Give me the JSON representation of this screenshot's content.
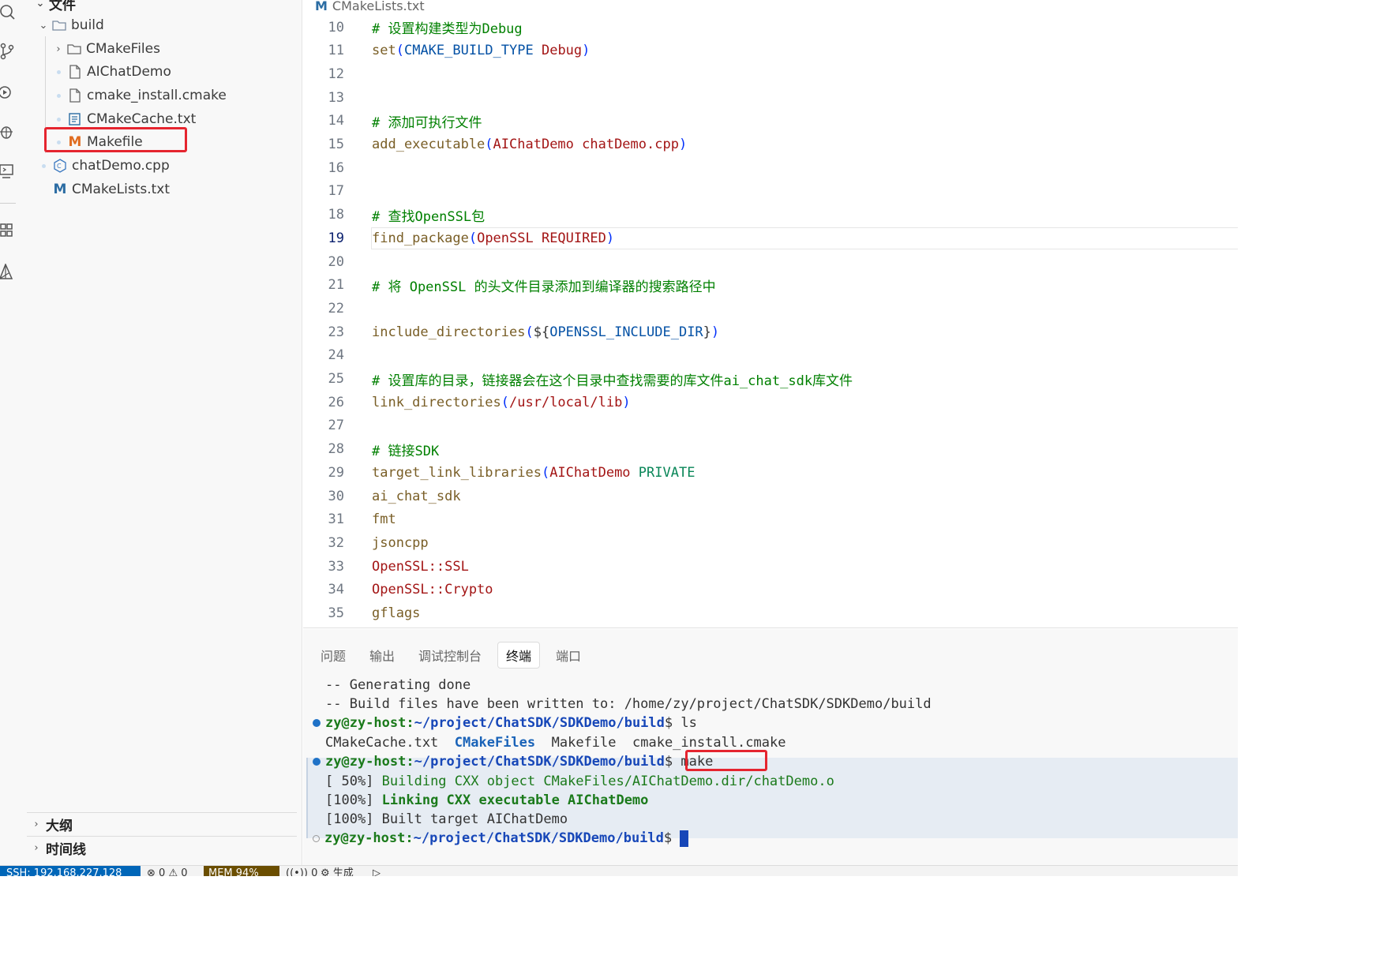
{
  "sidebar": {
    "section_title": "文件",
    "tree": [
      {
        "label": "build"
      },
      {
        "label": "CMakeFiles"
      },
      {
        "label": "AIChatDemo"
      },
      {
        "label": "cmake_install.cmake"
      },
      {
        "label": "CMakeCache.txt"
      },
      {
        "label": "Makefile",
        "icon_letter": "M"
      },
      {
        "label": "chatDemo.cpp"
      },
      {
        "label": "CMakeLists.txt",
        "icon_letter": "M"
      }
    ],
    "outline_label": "大纲",
    "timeline_label": "时间线"
  },
  "editor": {
    "tab_label": "CMakeLists.txt",
    "tab_icon_letter": "M",
    "active_line": 19,
    "lines": [
      {
        "n": "10",
        "tokens": [
          {
            "t": "# 设置构建类型为Debug",
            "c": "cmt"
          }
        ]
      },
      {
        "n": "11",
        "tokens": [
          {
            "t": "set",
            "c": "fn"
          },
          {
            "t": "(",
            "c": "brk"
          },
          {
            "t": "CMAKE_BUILD_TYPE",
            "c": "var"
          },
          {
            "t": " Debug",
            "c": "str"
          },
          {
            "t": ")",
            "c": "brk"
          }
        ]
      },
      {
        "n": "12",
        "tokens": []
      },
      {
        "n": "13",
        "tokens": []
      },
      {
        "n": "14",
        "tokens": [
          {
            "t": "# 添加可执行文件",
            "c": "cmt"
          }
        ]
      },
      {
        "n": "15",
        "tokens": [
          {
            "t": "add_executable",
            "c": "fn"
          },
          {
            "t": "(",
            "c": "brk"
          },
          {
            "t": "AIChatDemo chatDemo.cpp",
            "c": "str"
          },
          {
            "t": ")",
            "c": "brk"
          }
        ]
      },
      {
        "n": "16",
        "tokens": []
      },
      {
        "n": "17",
        "tokens": []
      },
      {
        "n": "18",
        "tokens": [
          {
            "t": "# 查找OpenSSL包",
            "c": "cmt"
          }
        ]
      },
      {
        "n": "19",
        "tokens": [
          {
            "t": "find_package",
            "c": "fn"
          },
          {
            "t": "(",
            "c": "brk"
          },
          {
            "t": "OpenSSL REQUIRED",
            "c": "str"
          },
          {
            "t": ")",
            "c": "brk"
          }
        ]
      },
      {
        "n": "20",
        "tokens": []
      },
      {
        "n": "21",
        "tokens": [
          {
            "t": "# 将 OpenSSL 的头文件目录添加到编译器的搜索路径中",
            "c": "cmt"
          }
        ]
      },
      {
        "n": "22",
        "tokens": []
      },
      {
        "n": "23",
        "tokens": [
          {
            "t": "include_directories",
            "c": "fn"
          },
          {
            "t": "(",
            "c": "brk"
          },
          {
            "t": "${",
            "c": "pl"
          },
          {
            "t": "OPENSSL_INCLUDE_DIR",
            "c": "var"
          },
          {
            "t": "}",
            "c": "pl"
          },
          {
            "t": ")",
            "c": "brk"
          }
        ]
      },
      {
        "n": "24",
        "tokens": []
      },
      {
        "n": "25",
        "tokens": [
          {
            "t": "# 设置库的目录，链接器会在这个目录中查找需要的库文件ai_chat_sdk库文件",
            "c": "cmt"
          }
        ]
      },
      {
        "n": "26",
        "tokens": [
          {
            "t": "link_directories",
            "c": "fn"
          },
          {
            "t": "(",
            "c": "brk"
          },
          {
            "t": "/usr/local/lib",
            "c": "str"
          },
          {
            "t": ")",
            "c": "brk"
          }
        ]
      },
      {
        "n": "27",
        "tokens": []
      },
      {
        "n": "28",
        "tokens": [
          {
            "t": "# 链接SDK",
            "c": "cmt"
          }
        ]
      },
      {
        "n": "29",
        "tokens": [
          {
            "t": "target_link_libraries",
            "c": "fn"
          },
          {
            "t": "(",
            "c": "brk"
          },
          {
            "t": "AIChatDemo",
            "c": "str"
          },
          {
            "t": " PRIVATE",
            "c": "kw"
          }
        ]
      },
      {
        "n": "30",
        "tokens": [
          {
            "t": "ai_chat_sdk",
            "c": "fn"
          }
        ]
      },
      {
        "n": "31",
        "tokens": [
          {
            "t": "fmt",
            "c": "fn"
          }
        ]
      },
      {
        "n": "32",
        "tokens": [
          {
            "t": "jsoncpp",
            "c": "fn"
          }
        ]
      },
      {
        "n": "33",
        "tokens": [
          {
            "t": "OpenSSL::SSL",
            "c": "str"
          }
        ]
      },
      {
        "n": "34",
        "tokens": [
          {
            "t": "OpenSSL::Crypto",
            "c": "str"
          }
        ]
      },
      {
        "n": "35",
        "tokens": [
          {
            "t": "gflags",
            "c": "fn"
          }
        ]
      }
    ]
  },
  "panel": {
    "tabs": [
      {
        "label": "问题",
        "active": false
      },
      {
        "label": "输出",
        "active": false
      },
      {
        "label": "调试控制台",
        "active": false
      },
      {
        "label": "终端",
        "active": true
      },
      {
        "label": "端口",
        "active": false
      }
    ],
    "terminal": {
      "prompt_user": "zy@zy-host",
      "prompt_path": "~/project/ChatSDK/SDKDemo/build",
      "line_generating": "-- Generating done",
      "line_written": "-- Build files have been written to: /home/zy/project/ChatSDK/SDKDemo/build",
      "cmd_ls": " ls",
      "ls_output": [
        {
          "name": "CMakeCache.txt",
          "dir": false
        },
        {
          "name": "CMakeFiles",
          "dir": true
        },
        {
          "name": "Makefile",
          "dir": false
        },
        {
          "name": "cmake_install.cmake",
          "dir": false
        }
      ],
      "cmd_make": " make",
      "build_pct_50": "[ 50%] ",
      "build_msg_50": "Building CXX object CMakeFiles/AIChatDemo.dir/chatDemo.o",
      "build_pct_100a": "[100%] ",
      "build_msg_link": "Linking CXX executable AIChatDemo",
      "build_pct_100b": "[100%] ",
      "build_msg_done": "Built target AIChatDemo"
    }
  },
  "statusbar": {
    "remote": "SSH: 192.168.227.128",
    "errors": "0",
    "warnings": "0",
    "mem": "MEM 94%",
    "ports": "0",
    "build_label": "生成"
  },
  "colors": {
    "accent_blue": "#0066b8",
    "highlight_red": "#e5252f",
    "makefile_icon": "#e06c20",
    "cmakelists_icon": "#2b6ca3"
  }
}
